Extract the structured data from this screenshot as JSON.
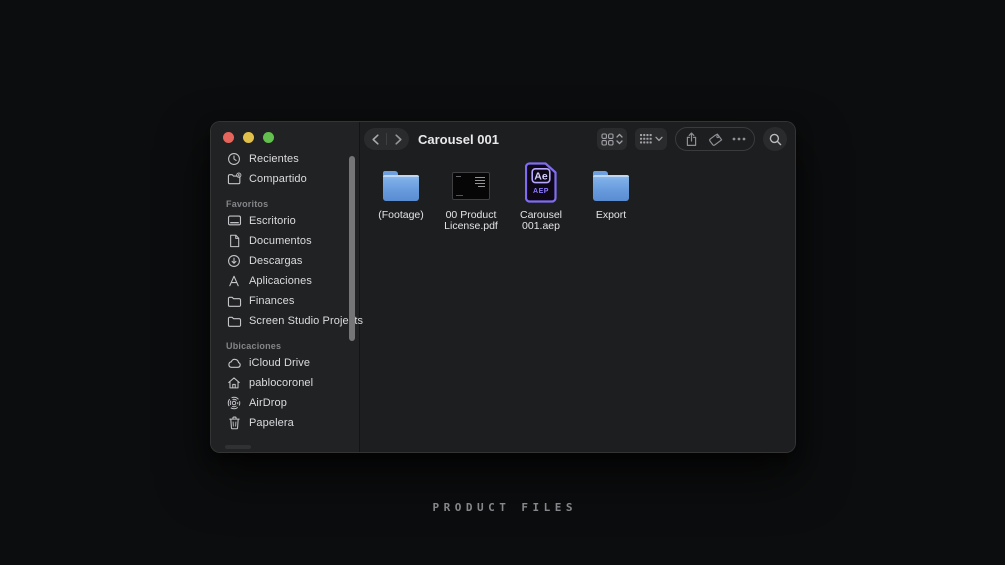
{
  "page": {
    "caption": "PRODUCT FILES"
  },
  "window": {
    "title": "Carousel 001",
    "colors": {
      "traffic_red": "#e5655c",
      "traffic_yellow": "#e0bf4a",
      "traffic_green": "#64c04e",
      "folder_blue": "#6fa0dd",
      "aep_purple": "#7f6cf0"
    },
    "toolbar": {
      "buttons": [
        {
          "name": "back-button",
          "icon": "chevron-left-icon"
        },
        {
          "name": "forward-button",
          "icon": "chevron-right-icon"
        },
        {
          "name": "view-options-button",
          "icon": "grid-view-icon"
        },
        {
          "name": "group-by-button",
          "icon": "group-list-icon"
        },
        {
          "name": "share-button",
          "icon": "share-icon"
        },
        {
          "name": "tags-button",
          "icon": "tag-icon"
        },
        {
          "name": "more-options-button",
          "icon": "ellipsis-icon"
        },
        {
          "name": "search-button",
          "icon": "search-icon"
        }
      ]
    },
    "sidebar": {
      "items_top": [
        {
          "label": "Recientes",
          "icon": "clock-icon"
        },
        {
          "label": "Compartido",
          "icon": "shared-folder-icon"
        }
      ],
      "sections": [
        {
          "label": "Favoritos",
          "items": [
            {
              "label": "Escritorio",
              "icon": "desktop-icon"
            },
            {
              "label": "Documentos",
              "icon": "document-icon"
            },
            {
              "label": "Descargas",
              "icon": "download-circle-icon"
            },
            {
              "label": "Aplicaciones",
              "icon": "applications-icon"
            },
            {
              "label": "Finances",
              "icon": "folder-outline-icon"
            },
            {
              "label": "Screen Studio Projects",
              "icon": "folder-outline-icon"
            }
          ]
        },
        {
          "label": "Ubicaciones",
          "items": [
            {
              "label": "iCloud Drive",
              "icon": "cloud-icon"
            },
            {
              "label": "pablocoronel",
              "icon": "home-icon"
            },
            {
              "label": "AirDrop",
              "icon": "airdrop-icon"
            },
            {
              "label": "Papelera",
              "icon": "trash-icon"
            }
          ]
        }
      ]
    },
    "files": [
      {
        "name": "(Footage)",
        "type": "folder"
      },
      {
        "name": "00 Product License.pdf",
        "type": "pdf"
      },
      {
        "name": "Carousel 001.aep",
        "type": "aep",
        "logo": "Ae",
        "badge": "AEP"
      },
      {
        "name": "Export",
        "type": "folder"
      }
    ]
  }
}
